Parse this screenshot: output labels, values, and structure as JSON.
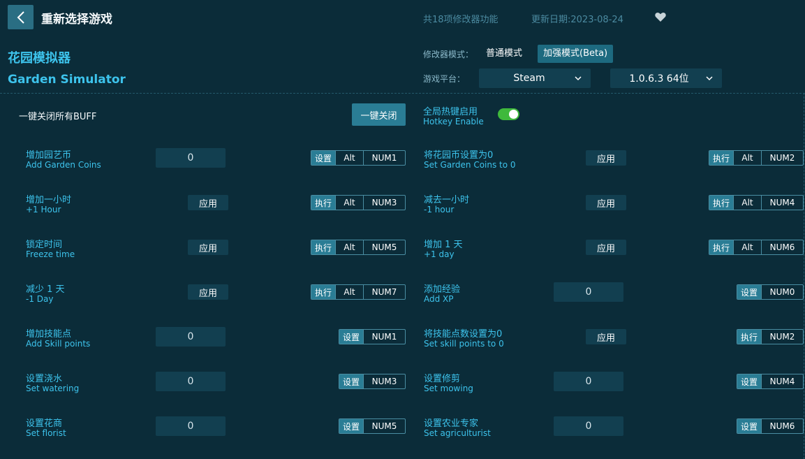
{
  "header": {
    "title": "重新选择游戏",
    "feature_count": "共18项修改器功能",
    "update_date": "更新日期:2023-08-24"
  },
  "game": {
    "name_cn": "花园模拟器",
    "name_en": "Garden Simulator"
  },
  "modifier": {
    "mode_label": "修改器模式：",
    "modes": [
      "普通模式",
      "加强模式(Beta)"
    ],
    "active_mode": "加强模式(Beta)",
    "platform_label": "游戏平台：",
    "platform": "Steam",
    "version": "1.0.6.3 64位"
  },
  "buff": {
    "label": "一键关闭所有BUFF",
    "close_button": "一键关闭",
    "hotkey_cn": "全局热键启用",
    "hotkey_en": "Hotkey Enable",
    "hotkey_enabled": true
  },
  "cheats_left": [
    {
      "cn": "增加园艺币",
      "en": "Add Garden Coins",
      "control": "input",
      "value": "0",
      "action": "设置",
      "keys": [
        "Alt",
        "NUM1"
      ]
    },
    {
      "cn": "增加一小时",
      "en": "+1 Hour",
      "control": "button",
      "button": "应用",
      "action": "执行",
      "keys": [
        "Alt",
        "NUM3"
      ]
    },
    {
      "cn": "锁定时间",
      "en": "Freeze time",
      "control": "button",
      "button": "应用",
      "action": "执行",
      "keys": [
        "Alt",
        "NUM5"
      ]
    },
    {
      "cn": "减少 1 天",
      "en": "-1 Day",
      "control": "button",
      "button": "应用",
      "action": "执行",
      "keys": [
        "Alt",
        "NUM7"
      ]
    },
    {
      "cn": "增加技能点",
      "en": "Add Skill points",
      "control": "input",
      "value": "0",
      "action": "设置",
      "keys": [
        "NUM1"
      ]
    },
    {
      "cn": "设置浇水",
      "en": "Set watering",
      "control": "input",
      "value": "0",
      "action": "设置",
      "keys": [
        "NUM3"
      ]
    },
    {
      "cn": "设置花商",
      "en": "Set florist",
      "control": "input",
      "value": "0",
      "action": "设置",
      "keys": [
        "NUM5"
      ]
    }
  ],
  "cheats_right": [
    {
      "cn": "将花园币设置为0",
      "en": "Set Garden Coins to 0",
      "control": "button",
      "button": "应用",
      "action": "执行",
      "keys": [
        "Alt",
        "NUM2"
      ]
    },
    {
      "cn": "减去一小时",
      "en": "-1 hour",
      "control": "button",
      "button": "应用",
      "action": "执行",
      "keys": [
        "Alt",
        "NUM4"
      ]
    },
    {
      "cn": "增加 1 天",
      "en": "+1 day",
      "control": "button",
      "button": "应用",
      "action": "执行",
      "keys": [
        "Alt",
        "NUM6"
      ]
    },
    {
      "cn": "添加经验",
      "en": "Add XP",
      "control": "input",
      "value": "0",
      "action": "设置",
      "keys": [
        "NUM0"
      ]
    },
    {
      "cn": "将技能点数设置为0",
      "en": "Set skill points to 0",
      "control": "button",
      "button": "应用",
      "action": "执行",
      "keys": [
        "NUM2"
      ]
    },
    {
      "cn": "设置修剪",
      "en": "Set mowing",
      "control": "input",
      "value": "0",
      "action": "设置",
      "keys": [
        "NUM4"
      ]
    },
    {
      "cn": "设置农业专家",
      "en": "Set agriculturist",
      "control": "input",
      "value": "0",
      "action": "设置",
      "keys": [
        "NUM6"
      ]
    }
  ]
}
